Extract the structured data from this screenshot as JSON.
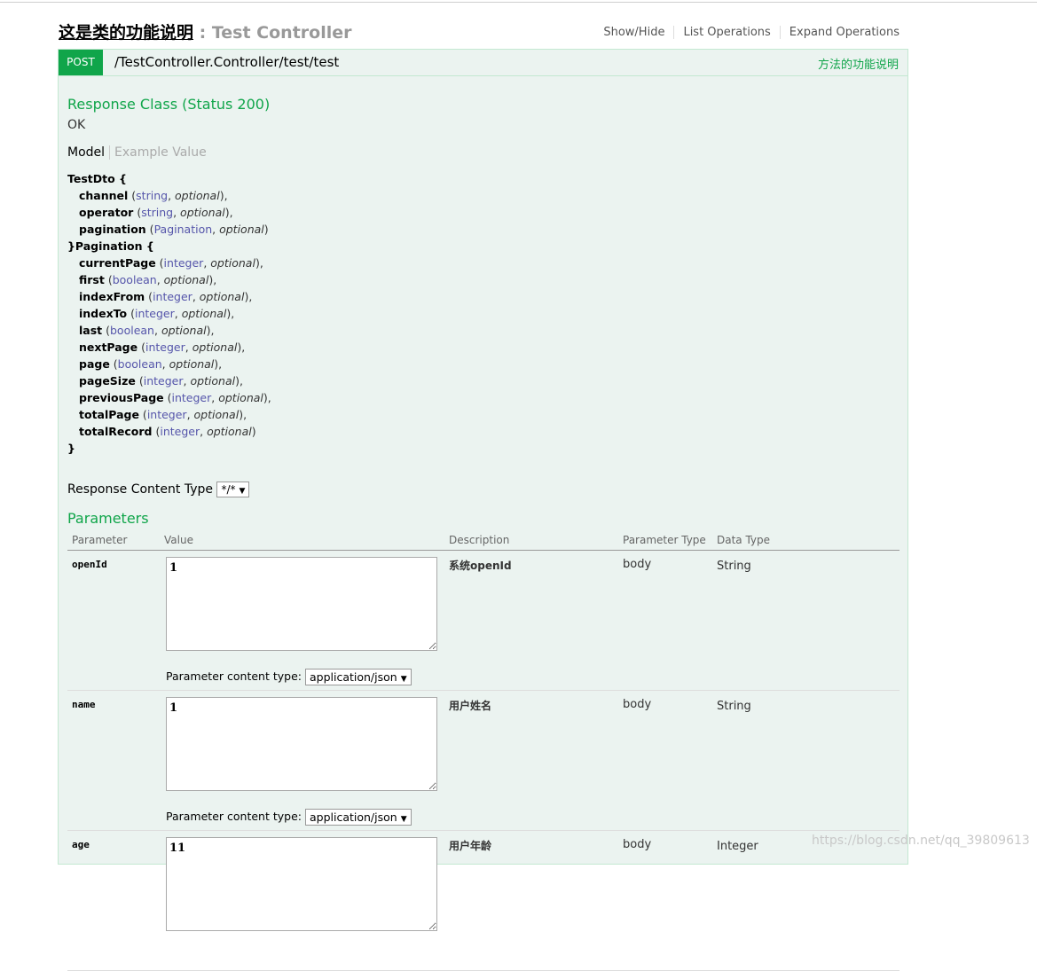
{
  "controller": {
    "title_cn": "这是类的功能说明",
    "separator": " : ",
    "title_en": "Test Controller",
    "links": [
      "Show/Hide",
      "List Operations",
      "Expand Operations"
    ]
  },
  "operation": {
    "method": "POST",
    "path": "/TestController.Controller/test/test",
    "summary": "方法的功能说明"
  },
  "response_class": {
    "title": "Response Class (Status 200)",
    "status_text": "OK",
    "tabs": {
      "model": "Model",
      "example": "Example Value"
    }
  },
  "model_lines": [
    {
      "indent": false,
      "name": "TestDto {",
      "type": "",
      "opt": "",
      "tail": ""
    },
    {
      "indent": true,
      "name": "channel",
      "type": "string",
      "opt": "optional",
      "tail": "),"
    },
    {
      "indent": true,
      "name": "operator",
      "type": "string",
      "opt": "optional",
      "tail": "),"
    },
    {
      "indent": true,
      "name": "pagination",
      "type": "Pagination",
      "opt": "optional",
      "tail": ")"
    },
    {
      "indent": false,
      "name": "}Pagination {",
      "type": "",
      "opt": "",
      "tail": ""
    },
    {
      "indent": true,
      "name": "currentPage",
      "type": "integer",
      "opt": "optional",
      "tail": "),"
    },
    {
      "indent": true,
      "name": "first",
      "type": "boolean",
      "opt": "optional",
      "tail": "),"
    },
    {
      "indent": true,
      "name": "indexFrom",
      "type": "integer",
      "opt": "optional",
      "tail": "),"
    },
    {
      "indent": true,
      "name": "indexTo",
      "type": "integer",
      "opt": "optional",
      "tail": "),"
    },
    {
      "indent": true,
      "name": "last",
      "type": "boolean",
      "opt": "optional",
      "tail": "),"
    },
    {
      "indent": true,
      "name": "nextPage",
      "type": "integer",
      "opt": "optional",
      "tail": "),"
    },
    {
      "indent": true,
      "name": "page",
      "type": "boolean",
      "opt": "optional",
      "tail": "),"
    },
    {
      "indent": true,
      "name": "pageSize",
      "type": "integer",
      "opt": "optional",
      "tail": "),"
    },
    {
      "indent": true,
      "name": "previousPage",
      "type": "integer",
      "opt": "optional",
      "tail": "),"
    },
    {
      "indent": true,
      "name": "totalPage",
      "type": "integer",
      "opt": "optional",
      "tail": "),"
    },
    {
      "indent": true,
      "name": "totalRecord",
      "type": "integer",
      "opt": "optional",
      "tail": ")"
    },
    {
      "indent": false,
      "name": "}",
      "type": "",
      "opt": "",
      "tail": ""
    }
  ],
  "response_content_type": {
    "label": "Response Content Type",
    "value": "*/*"
  },
  "parameters": {
    "title": "Parameters",
    "headers": [
      "Parameter",
      "Value",
      "Description",
      "Parameter Type",
      "Data Type"
    ],
    "content_type_label": "Parameter content type:",
    "content_type_value": "application/json",
    "rows": [
      {
        "name": "openId",
        "value": "1",
        "description": "系统openId",
        "param_type": "body",
        "data_type": "String"
      },
      {
        "name": "name",
        "value": "1",
        "description": "用户姓名",
        "param_type": "body",
        "data_type": "String"
      },
      {
        "name": "age",
        "value": "11",
        "description": "用户年龄",
        "param_type": "body",
        "data_type": "Integer"
      }
    ]
  },
  "watermark": "https://blog.csdn.net/qq_39809613",
  "colors": {
    "post_green": "#10a54a",
    "op_background": "#ebf3f0",
    "op_border": "#c3e8d1"
  }
}
